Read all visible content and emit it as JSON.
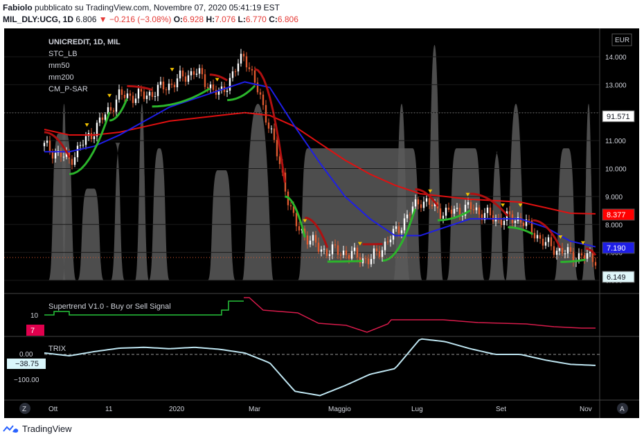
{
  "header": {
    "author": "Fabiolo",
    "published": "pubblicato su TradingView.com, Novembre 07, 2020 05:41:19 EST",
    "symbol": "MIL_DLY:UCG, 1D",
    "last": "6.806",
    "change": "−0.216 (−3.08%)",
    "o_label": "O:",
    "o": "6.928",
    "h_label": "H:",
    "h": "7.076",
    "l_label": "L:",
    "l": "6.770",
    "c_label": "C:",
    "c": "6.806"
  },
  "legend": {
    "title": "UNICREDIT, 1D, MIL",
    "items": [
      "STC_LB",
      "mm50",
      "mm200",
      "CM_P-SAR"
    ]
  },
  "currency": "EUR",
  "price_axis": {
    "ticks": [
      "14.000",
      "13.000",
      "12.000",
      "11.000",
      "10.000",
      "9.000",
      "8.000",
      "7.000",
      "6.000"
    ],
    "badges": [
      {
        "label": "91.571",
        "value": 12.0,
        "color": "#ffffff",
        "text": "#131722"
      },
      {
        "label": "8.377",
        "value": 8.377,
        "color": "#ff0000",
        "text": "#ffffff"
      },
      {
        "label": "7.190",
        "value": 7.19,
        "color": "#1e1ee6",
        "text": "#ffffff"
      },
      {
        "label": "6.149",
        "value": 6.149,
        "color": "#e0f7fa",
        "text": "#131722"
      }
    ]
  },
  "supertrend": {
    "title": "Supertrend V1.0 - Buy or Sell Signal",
    "tick": "10",
    "badge": "7"
  },
  "trix": {
    "title": "TRIX",
    "ticks": [
      "0.00",
      "−100.00"
    ],
    "badge": "−38.75"
  },
  "time_axis": [
    "Ott",
    "11",
    "2020",
    "Mar",
    "Maggio",
    "Lug",
    "Set",
    "Nov"
  ],
  "corner_left": "Z",
  "corner_right": "A",
  "footer": "TradingView",
  "colors": {
    "background": "#000000",
    "mm50": "#1e1ee6",
    "mm200": "#e01010",
    "sar_up": "#2bb52b",
    "sar_down": "#b01010",
    "stc_fill": "#5a5a5a",
    "candle_up": "#ffffff",
    "candle_down": "#e05a30",
    "marker": "#f2c200",
    "trix": "#bfe6f2"
  },
  "chart_data": {
    "type": "line",
    "title": "UNICREDIT, 1D, MIL",
    "x": [
      "2019-09-20",
      "2019-10-05",
      "2019-10-25",
      "2019-11-15",
      "2019-12-05",
      "2019-12-25",
      "2020-01-15",
      "2020-02-05",
      "2020-02-20",
      "2020-03-05",
      "2020-03-20",
      "2020-04-05",
      "2020-04-25",
      "2020-05-15",
      "2020-06-05",
      "2020-06-25",
      "2020-07-15",
      "2020-08-05",
      "2020-08-25",
      "2020-09-15",
      "2020-10-05",
      "2020-10-25",
      "2020-11-06"
    ],
    "series": [
      {
        "name": "Close",
        "values": [
          10.8,
          10.3,
          11.4,
          12.6,
          12.6,
          13.0,
          13.5,
          12.6,
          14.1,
          11.5,
          8.0,
          7.1,
          7.0,
          6.7,
          7.7,
          8.9,
          8.4,
          8.6,
          8.2,
          8.2,
          7.3,
          6.9,
          6.8
        ]
      },
      {
        "name": "mm50",
        "values": [
          10.6,
          10.6,
          10.8,
          11.2,
          11.7,
          12.2,
          12.5,
          12.8,
          13.1,
          12.9,
          11.5,
          10.2,
          9.0,
          8.2,
          7.6,
          7.6,
          7.9,
          8.2,
          8.2,
          8.2,
          7.9,
          7.4,
          7.2
        ]
      },
      {
        "name": "mm200",
        "values": [
          11.4,
          11.2,
          11.2,
          11.3,
          11.5,
          11.7,
          11.8,
          11.9,
          12.0,
          11.9,
          11.5,
          10.9,
          10.3,
          9.8,
          9.4,
          9.1,
          9.0,
          8.9,
          8.85,
          8.8,
          8.6,
          8.4,
          8.38
        ]
      },
      {
        "name": "TRIX",
        "values": [
          5,
          -5,
          10,
          22,
          25,
          20,
          25,
          18,
          5,
          -30,
          -130,
          -145,
          -110,
          -70,
          -50,
          55,
          45,
          20,
          0,
          0,
          -20,
          -35,
          -38.75
        ]
      }
    ],
    "ylim": [
      6.0,
      14.6
    ],
    "trix_ylim": [
      -160,
      50
    ]
  }
}
